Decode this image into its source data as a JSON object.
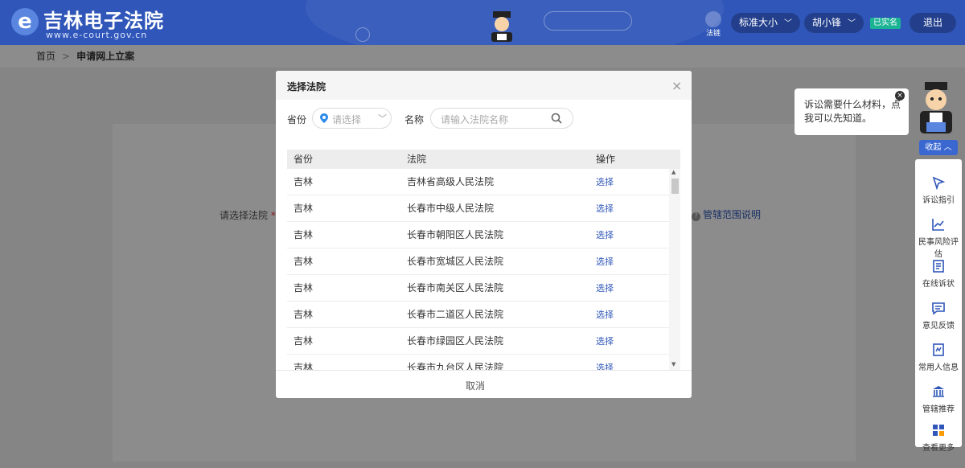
{
  "header": {
    "title": "吉林电子法院",
    "url": "www.e-court.gov.cn",
    "law_badge": "法链",
    "font_size_select": "标准大小",
    "user_name": "胡小锋",
    "verified_badge": "已实名",
    "logout": "退出"
  },
  "breadcrumb": {
    "home": "首页",
    "separator": ">",
    "current": "申请网上立案"
  },
  "background_form": {
    "court_label": "请选择法院",
    "required_mark": "*",
    "scope_link": "管辖范围说明"
  },
  "modal": {
    "title": "选择法院",
    "province_label": "省份",
    "province_placeholder": "请选择",
    "name_label": "名称",
    "name_placeholder": "请输入法院名称",
    "columns": [
      "省份",
      "法院",
      "操作"
    ],
    "rows": [
      {
        "province": "吉林",
        "court": "吉林省高级人民法院",
        "action": "选择"
      },
      {
        "province": "吉林",
        "court": "长春市中级人民法院",
        "action": "选择"
      },
      {
        "province": "吉林",
        "court": "长春市朝阳区人民法院",
        "action": "选择"
      },
      {
        "province": "吉林",
        "court": "长春市宽城区人民法院",
        "action": "选择"
      },
      {
        "province": "吉林",
        "court": "长春市南关区人民法院",
        "action": "选择"
      },
      {
        "province": "吉林",
        "court": "长春市二道区人民法院",
        "action": "选择"
      },
      {
        "province": "吉林",
        "court": "长春市绿园区人民法院",
        "action": "选择"
      },
      {
        "province": "吉林",
        "court": "长春市九台区人民法院",
        "action": "选择"
      }
    ],
    "cancel": "取消"
  },
  "tip": {
    "text_line1": "诉讼需要什么材料，点",
    "text_line2": "我可以先知道。",
    "close": "×"
  },
  "side": {
    "collapse": "收起",
    "items": [
      "诉讼指引",
      "民事风险评估",
      "在线诉状",
      "意见反馈",
      "常用人信息",
      "管辖推荐",
      "查看更多"
    ]
  },
  "colors": {
    "header": "#2f56b8",
    "link": "#2f56b8",
    "verified": "#1ab394"
  }
}
